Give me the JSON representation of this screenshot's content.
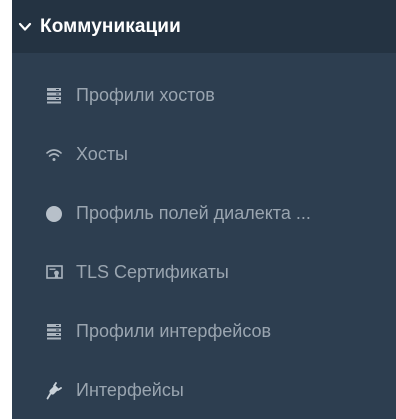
{
  "section": {
    "title": "Коммуникации",
    "expanded": true
  },
  "menu": {
    "items": [
      {
        "label": "Профили хостов",
        "icon": "server-stack-icon"
      },
      {
        "label": "Хосты",
        "icon": "wifi-icon"
      },
      {
        "label": "Профиль полей диалекта ...",
        "icon": "circle-icon"
      },
      {
        "label": "TLS Сертификаты",
        "icon": "certificate-icon"
      },
      {
        "label": "Профили интерфейсов",
        "icon": "server-stack-icon"
      },
      {
        "label": "Интерфейсы",
        "icon": "plug-icon"
      }
    ]
  },
  "colors": {
    "panel_bg": "#2d3e50",
    "header_bg": "#243342",
    "header_text": "#ffffff",
    "item_text": "#9aa5b0",
    "icon_color": "#aab4be"
  }
}
